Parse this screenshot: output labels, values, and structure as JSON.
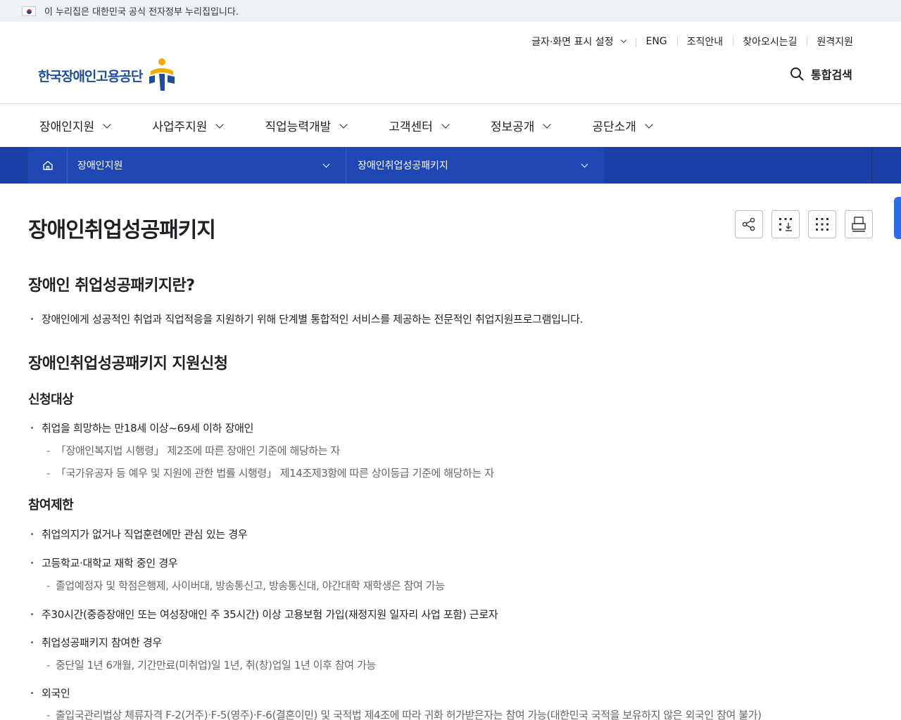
{
  "gov_banner": {
    "text": "이 누리집은 대한민국 공식 전자정부 누리집입니다."
  },
  "header": {
    "util": [
      {
        "label": "글자·화면 표시 설정"
      },
      {
        "label": "ENG"
      },
      {
        "label": "조직안내"
      },
      {
        "label": "찾아오시는길"
      },
      {
        "label": "원격지원"
      }
    ],
    "logo_text": "한국장애인고용공단",
    "search_label": "통합검색"
  },
  "gnb": [
    "장애인지원",
    "사업주지원",
    "직업능력개발",
    "고객센터",
    "정보공개",
    "공단소개"
  ],
  "location": {
    "depth1": "장애인지원",
    "depth2": "장애인취업성공패키지"
  },
  "content": {
    "title": "장애인취업성공패키지",
    "sec1": {
      "heading": "장애인 취업성공패키지란?",
      "item": "장애인에게 성공적인 취업과 직업적응을 지원하기 위해 단계별 통합적인 서비스를 제공하는 전문적인 취업지원프로그램입니다."
    },
    "sec2": {
      "heading": "장애인취업성공패키지 지원신청",
      "target_heading": "신청대상",
      "target_item": "취업을 희망하는 만18세 이상~69세 이하 장애인",
      "target_sub1": "「장애인복지법 시행령」 제2조에 따른 장애인 기준에 해당하는 자",
      "target_sub2": "「국가유공자 등 예우 및 지원에 관한 법률 시행령」 제14조제3항에 따른 상이등급 기준에 해당하는 자",
      "limit_heading": "참여제한",
      "limit1": "취업의지가 없거나 직업훈련에만 관심 있는 경우",
      "limit2": "고등학교·대학교 재학 중인 경우",
      "limit2_sub": "졸업예정자 및 학점은행제, 사이버대, 방송통신고, 방송통신대, 야간대학 재학생은 참여 가능",
      "limit3": "주30시간(중증장애인 또는 여성장애인 주 35시간) 이상 고용보험 가입(재정지원 일자리 사업 포함) 근로자",
      "limit4": "취업성공패키지 참여한 경우",
      "limit4_sub": "중단일 1년 6개월, 기간만료(미취업)일 1년, 취(창)업일 1년 이후 참여 가능",
      "limit5": "외국인",
      "limit5_sub": "출입국관리법상 체류자격 F-2(거주)·F-5(영주)·F-6(결혼이민) 및 국적법 제4조에 따라 귀화 허가받은자는 참여 가능(대한민국 국적을 보유하지 않은 외국인 참여 불가)"
    }
  }
}
